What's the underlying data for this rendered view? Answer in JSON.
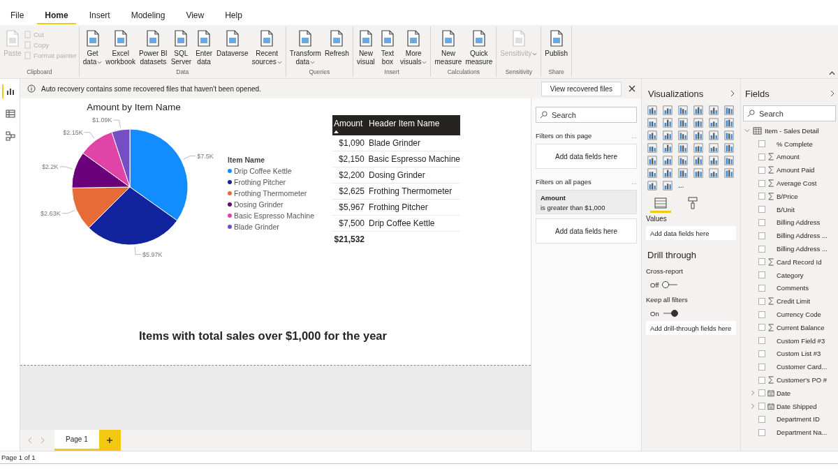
{
  "menu_tabs": [
    {
      "label": "File",
      "selected": false
    },
    {
      "label": "Home",
      "selected": true
    },
    {
      "label": "Insert",
      "selected": false
    },
    {
      "label": "Modeling",
      "selected": false
    },
    {
      "label": "View",
      "selected": false
    },
    {
      "label": "Help",
      "selected": false
    }
  ],
  "ribbon": {
    "groups": [
      {
        "label": "Clipboard",
        "buttons": [
          {
            "kind": "large",
            "lines": [
              "Paste"
            ],
            "disabled": true
          },
          {
            "kind": "small",
            "lines": [
              "Cut"
            ],
            "disabled": true
          },
          {
            "kind": "small",
            "lines": [
              "Copy"
            ],
            "disabled": true
          },
          {
            "kind": "small",
            "lines": [
              "Format painter"
            ],
            "disabled": true
          }
        ]
      },
      {
        "label": "Data",
        "buttons": [
          {
            "kind": "large",
            "lines": [
              "Get",
              "data"
            ],
            "dropdown": true,
            "disabled": false
          },
          {
            "kind": "large",
            "lines": [
              "Excel",
              "workbook"
            ],
            "dropdown": false,
            "disabled": false
          },
          {
            "kind": "large",
            "lines": [
              "Power BI",
              "datasets"
            ],
            "dropdown": false,
            "disabled": false
          },
          {
            "kind": "large",
            "lines": [
              "SQL",
              "Server"
            ],
            "dropdown": false,
            "disabled": false
          },
          {
            "kind": "large",
            "lines": [
              "Enter",
              "data"
            ],
            "dropdown": false,
            "disabled": false
          },
          {
            "kind": "large",
            "lines": [
              "Dataverse"
            ],
            "dropdown": false,
            "disabled": false
          },
          {
            "kind": "large",
            "lines": [
              "Recent",
              "sources"
            ],
            "dropdown": true,
            "disabled": false
          }
        ]
      },
      {
        "label": "Queries",
        "buttons": [
          {
            "kind": "large",
            "lines": [
              "Transform",
              "data"
            ],
            "dropdown": true,
            "disabled": false
          },
          {
            "kind": "large",
            "lines": [
              "Refresh"
            ],
            "dropdown": false,
            "disabled": false
          }
        ]
      },
      {
        "label": "Insert",
        "buttons": [
          {
            "kind": "large",
            "lines": [
              "New",
              "visual"
            ],
            "dropdown": false,
            "disabled": false
          },
          {
            "kind": "large",
            "lines": [
              "Text",
              "box"
            ],
            "dropdown": false,
            "disabled": false
          },
          {
            "kind": "large",
            "lines": [
              "More",
              "visuals"
            ],
            "dropdown": true,
            "disabled": false
          }
        ]
      },
      {
        "label": "Calculations",
        "buttons": [
          {
            "kind": "large",
            "lines": [
              "New",
              "measure"
            ],
            "dropdown": false,
            "disabled": false
          },
          {
            "kind": "large",
            "lines": [
              "Quick",
              "measure"
            ],
            "dropdown": false,
            "disabled": false
          }
        ]
      },
      {
        "label": "Sensitivity",
        "buttons": [
          {
            "kind": "large",
            "lines": [
              "Sensitivity"
            ],
            "dropdown": true,
            "disabled": true
          }
        ]
      },
      {
        "label": "Share",
        "buttons": [
          {
            "kind": "large",
            "lines": [
              "Publish"
            ],
            "dropdown": false,
            "disabled": false
          }
        ]
      }
    ]
  },
  "view_rail": [
    {
      "selected": true
    },
    {
      "selected": false
    },
    {
      "selected": false
    }
  ],
  "notification": {
    "message": "Auto recovery contains some recovered files that haven't been opened.",
    "button": "View recovered files"
  },
  "pie_visual": {
    "chart_data": {
      "type": "pie",
      "title": "Amount by Item Name",
      "categories": [
        "Drip Coffee Kettle",
        "Frothing Pitcher",
        "Frothing Thermometer",
        "Dosing Grinder",
        "Basic Espresso Machine",
        "Blade Grinder"
      ],
      "values": [
        7500,
        5967,
        2625,
        2200,
        2150,
        1090
      ],
      "colors": [
        "#118dff",
        "#12239e",
        "#e66c37",
        "#6b007b",
        "#e044a7",
        "#744ec2"
      ],
      "value_labels": [
        "$7.5K",
        "$5.97K",
        "$2.63K",
        "$2.2K",
        "$2.15K",
        "$1.09K"
      ],
      "legend_title": "Item Name"
    }
  },
  "table_visual": {
    "columns": [
      "Amount",
      "Header Item Name"
    ],
    "rows": [
      [
        "$1,090",
        "Blade Grinder"
      ],
      [
        "$2,150",
        "Basic Espresso Machine"
      ],
      [
        "$2,200",
        "Dosing Grinder"
      ],
      [
        "$2,625",
        "Frothing Thermometer"
      ],
      [
        "$5,967",
        "Frothing Pitcher"
      ],
      [
        "$7,500",
        "Drip Coffee Kettle"
      ]
    ],
    "total": "$21,532"
  },
  "text_box": "Items with total sales over $1,000 for the year",
  "page_tabs": [
    {
      "label": "Page 1",
      "selected": true
    }
  ],
  "status_bar": "Page 1 of 1",
  "filters": {
    "search_placeholder": "Search",
    "page_section": "Filters on this page",
    "page_more": "...",
    "page_well": "Add data fields here",
    "all_section": "Filters on all pages",
    "all_more": "...",
    "filter_card": {
      "field": "Amount",
      "condition": "is greater than $1,000"
    },
    "all_well": "Add data fields here"
  },
  "visualizations": {
    "title": "Visualizations",
    "more": "...",
    "tabs": [
      {
        "selected": true
      },
      {
        "selected": false
      }
    ],
    "values_label": "Values",
    "values_well": "Add data fields here",
    "drill_title": "Drill through",
    "cross_report": {
      "label": "Cross-report",
      "state": "Off",
      "on": false
    },
    "keep_filters": {
      "label": "Keep all filters",
      "state": "On",
      "on": true
    },
    "drill_well": "Add drill-through fields here"
  },
  "fields": {
    "title": "Fields",
    "search_placeholder": "Search",
    "tables": [
      {
        "name": "Item - Sales Detail",
        "expanded": true,
        "children": [
          {
            "name": "% Complete",
            "kind": "text",
            "checked": false
          },
          {
            "name": "Amount",
            "kind": "sum",
            "checked": false
          },
          {
            "name": "Amount Paid",
            "kind": "sum",
            "checked": false
          },
          {
            "name": "Average Cost",
            "kind": "sum",
            "checked": false
          },
          {
            "name": "B/Price",
            "kind": "sum",
            "checked": false
          },
          {
            "name": "B/Unit",
            "kind": "text",
            "checked": false
          },
          {
            "name": "Billing Address",
            "kind": "text",
            "checked": false
          },
          {
            "name": "Billing Address ...",
            "kind": "text",
            "checked": false
          },
          {
            "name": "Billing Address ...",
            "kind": "text",
            "checked": false
          },
          {
            "name": "Card Record Id",
            "kind": "sum",
            "checked": false
          },
          {
            "name": "Category",
            "kind": "text",
            "checked": false
          },
          {
            "name": "Comments",
            "kind": "text",
            "checked": false
          },
          {
            "name": "Credit Limit",
            "kind": "sum",
            "checked": false
          },
          {
            "name": "Currency Code",
            "kind": "text",
            "checked": false
          },
          {
            "name": "Current Balance",
            "kind": "sum",
            "checked": false
          },
          {
            "name": "Custom Field #3",
            "kind": "text",
            "checked": false
          },
          {
            "name": "Custom List #3",
            "kind": "text",
            "checked": false
          },
          {
            "name": "Customer Card...",
            "kind": "text",
            "checked": false
          },
          {
            "name": "Customer's PO #",
            "kind": "sum",
            "checked": false
          },
          {
            "name": "Date",
            "kind": "date",
            "checked": false,
            "expanded": false
          },
          {
            "name": "Date Shipped",
            "kind": "date",
            "checked": false,
            "expanded": false
          },
          {
            "name": "Department ID",
            "kind": "text",
            "checked": false
          },
          {
            "name": "Department Na...",
            "kind": "text",
            "checked": false
          }
        ]
      }
    ]
  }
}
